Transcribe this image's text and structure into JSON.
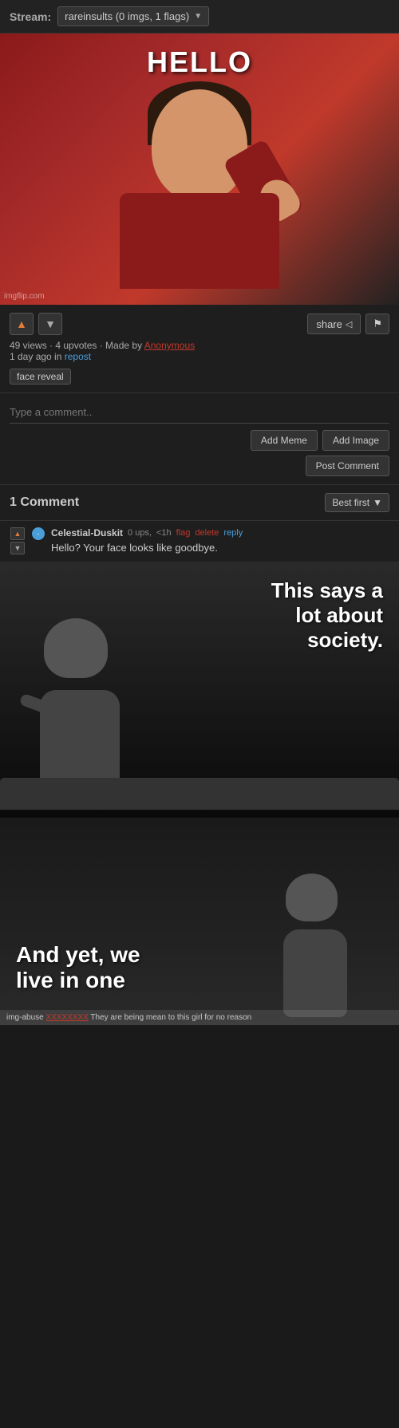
{
  "stream": {
    "label": "Stream:",
    "value": "rareinsults (0 imgs, 1 flags)",
    "chevron": "▼"
  },
  "meme": {
    "hello_text": "HELLO",
    "watermark": "imgflip.com"
  },
  "actions": {
    "share_label": "share",
    "share_icon": "◁",
    "meta": "49 views · 4 upvotes · Made by",
    "author": "Anonymous",
    "time": "1 day ago in",
    "repost": "repost",
    "tag": "face reveal"
  },
  "comment_input": {
    "placeholder": "Type a comment..",
    "add_meme": "Add Meme",
    "add_image": "Add Image",
    "post_comment": "Post Comment"
  },
  "comments": {
    "count": "1 Comment",
    "sort_label": "Best first",
    "sort_chevron": "▼"
  },
  "comment_item": {
    "author": "Celestial-Duskit",
    "ups": "0 ups,",
    "time": "<1h",
    "flag": "flag",
    "delete": "delete",
    "reply": "reply",
    "text": "Hello? Your face looks like goodbye."
  },
  "society_meme": {
    "text_line1": "This says a",
    "text_line2": "lot about",
    "text_line3": "society."
  },
  "andyet_meme": {
    "line1": "And yet, we",
    "line2": "live in one"
  },
  "imgabuse": {
    "prefix": "img-abuse ",
    "user": "XXXXXXXX",
    "suffix": " They are being mean to this girl for no reason"
  }
}
